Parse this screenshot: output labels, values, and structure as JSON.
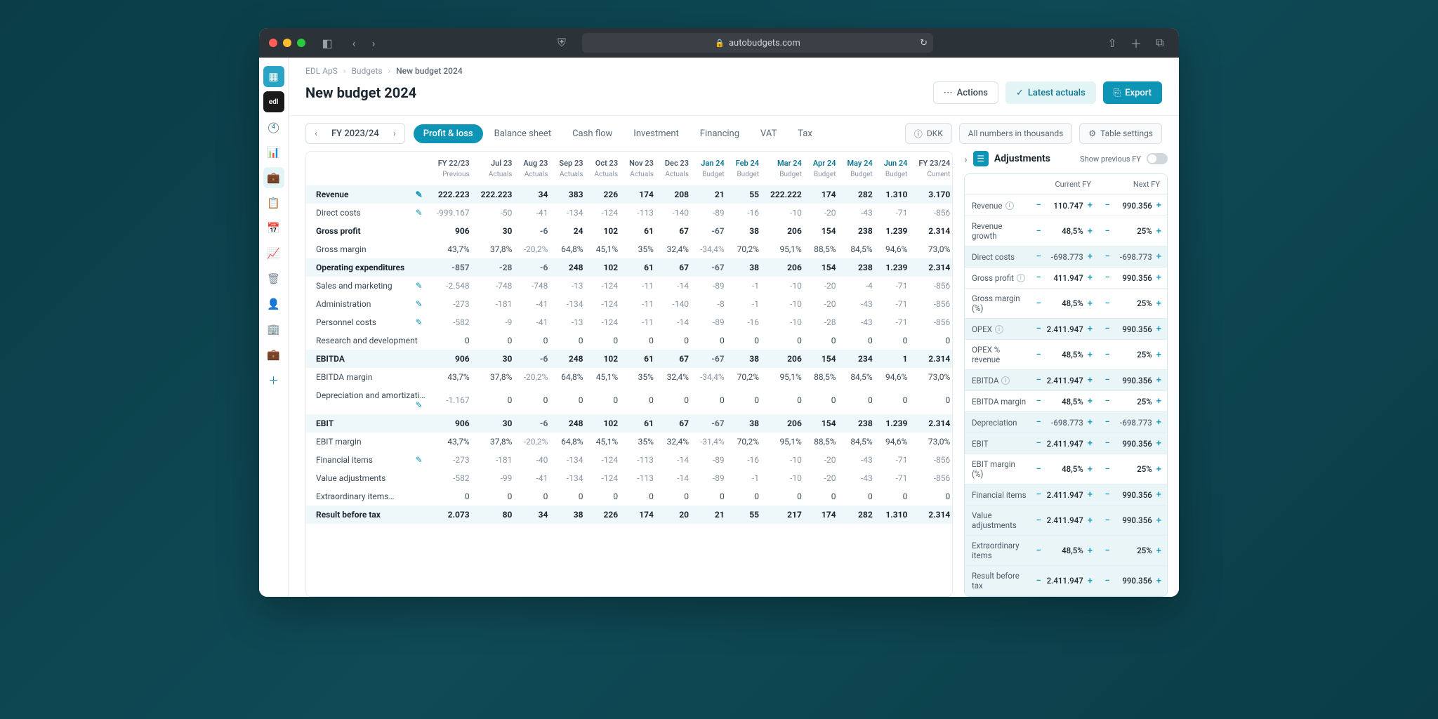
{
  "browser": {
    "url": "autobudgets.com"
  },
  "breadcrumbs": [
    "EDL ApS",
    "Budgets",
    "New budget 2024"
  ],
  "pageTitle": "New budget 2024",
  "headerButtons": {
    "actions": "Actions",
    "latest": "Latest actuals",
    "export": "Export"
  },
  "fy": "FY 2023/24",
  "tabs": [
    "Profit & loss",
    "Balance sheet",
    "Cash flow",
    "Investment",
    "Financing",
    "VAT",
    "Tax"
  ],
  "chips": {
    "currency": "DKK",
    "thousands": "All numbers in thousands",
    "settings": "Table settings"
  },
  "adjustments": {
    "title": "Adjustments",
    "showPrev": "Show previous FY",
    "cols": [
      "Current FY",
      "Next FY"
    ]
  },
  "columns": [
    {
      "p": "FY 22/23",
      "s": "Previous"
    },
    {
      "p": "Jul 23",
      "s": "Actuals"
    },
    {
      "p": "Aug 23",
      "s": "Actuals"
    },
    {
      "p": "Sep 23",
      "s": "Actuals"
    },
    {
      "p": "Oct 23",
      "s": "Actuals"
    },
    {
      "p": "Nov 23",
      "s": "Actuals"
    },
    {
      "p": "Dec 23",
      "s": "Actuals"
    },
    {
      "p": "Jan 24",
      "s": "Budget",
      "b": true
    },
    {
      "p": "Feb 24",
      "s": "Budget",
      "b": true
    },
    {
      "p": "Mar 24",
      "s": "Budget",
      "b": true
    },
    {
      "p": "Apr 24",
      "s": "Budget",
      "b": true
    },
    {
      "p": "May 24",
      "s": "Budget",
      "b": true
    },
    {
      "p": "Jun 24",
      "s": "Budget",
      "b": true
    },
    {
      "p": "FY 23/24",
      "s": "Current"
    }
  ],
  "rows": [
    {
      "label": "Revenue",
      "bold": true,
      "shaded": true,
      "edit": true,
      "vals": [
        "222.223",
        "222.223",
        "34",
        "383",
        "226",
        "174",
        "208",
        "21",
        "55",
        "222.222",
        "174",
        "282",
        "1.310",
        "3.170"
      ]
    },
    {
      "label": "Direct costs",
      "edit": true,
      "vals": [
        "-999.167",
        "-50",
        "-41",
        "-134",
        "-124",
        "-113",
        "-140",
        "-89",
        "-16",
        "-10",
        "-20",
        "-43",
        "-71",
        "-856"
      ]
    },
    {
      "label": "Gross profit",
      "bold": true,
      "vals": [
        "906",
        "30",
        "-6",
        "24",
        "102",
        "61",
        "67",
        "-67",
        "38",
        "206",
        "154",
        "238",
        "1.239",
        "2.314"
      ]
    },
    {
      "label": "Gross margin",
      "vals": [
        "43,7%",
        "37,8%",
        "-20,2%",
        "64,8%",
        "45,1%",
        "35%",
        "32,4%",
        "-34,4%",
        "70,2%",
        "95,1%",
        "88,5%",
        "84,5%",
        "94,6%",
        "73,0%"
      ]
    },
    {
      "label": "Operating expenditures",
      "bold": true,
      "shaded": true,
      "vals": [
        "-857",
        "-28",
        "-6",
        "248",
        "102",
        "61",
        "67",
        "-67",
        "38",
        "206",
        "154",
        "238",
        "1.239",
        "2.314"
      ]
    },
    {
      "label": "Sales and marketing",
      "edit": true,
      "vals": [
        "-2.548",
        "-748",
        "-748",
        "-13",
        "-124",
        "-11",
        "-14",
        "-89",
        "-1",
        "-10",
        "-20",
        "-4",
        "-71",
        "-856"
      ]
    },
    {
      "label": "Administration",
      "edit": true,
      "vals": [
        "-273",
        "-181",
        "-41",
        "-134",
        "-124",
        "-11",
        "-140",
        "-8",
        "-1",
        "-10",
        "-20",
        "-43",
        "-71",
        "-856"
      ]
    },
    {
      "label": "Personnel costs",
      "edit": true,
      "vals": [
        "-582",
        "-9",
        "-41",
        "-13",
        "-124",
        "-11",
        "-14",
        "-89",
        "-16",
        "-10",
        "-28",
        "-43",
        "-71",
        "-856"
      ]
    },
    {
      "label": "Research and development",
      "vals": [
        "0",
        "0",
        "0",
        "0",
        "0",
        "0",
        "0",
        "0",
        "0",
        "0",
        "0",
        "0",
        "0",
        "0"
      ]
    },
    {
      "label": "EBITDA",
      "bold": true,
      "shaded": true,
      "vals": [
        "906",
        "30",
        "-6",
        "248",
        "102",
        "61",
        "67",
        "-67",
        "38",
        "206",
        "154",
        "234",
        "1",
        "2.314"
      ]
    },
    {
      "label": "EBITDA margin",
      "vals": [
        "43,7%",
        "37,8%",
        "-20,2%",
        "64,8%",
        "45,1%",
        "35%",
        "32,4%",
        "-34,4%",
        "70,2%",
        "95,1%",
        "88,5%",
        "84,5%",
        "94,6%",
        "73,0%"
      ]
    },
    {
      "label": "Depreciation and amortizati…",
      "edit": true,
      "vals": [
        "-1.167",
        "0",
        "0",
        "0",
        "0",
        "0",
        "0",
        "0",
        "0",
        "0",
        "0",
        "0",
        "0",
        "0"
      ]
    },
    {
      "label": "EBIT",
      "bold": true,
      "shaded": true,
      "vals": [
        "906",
        "30",
        "-6",
        "248",
        "102",
        "61",
        "67",
        "-67",
        "38",
        "206",
        "154",
        "238",
        "1.239",
        "2.314"
      ]
    },
    {
      "label": "EBIT margin",
      "vals": [
        "43,7%",
        "37,8%",
        "-20,2%",
        "64,8%",
        "45,1%",
        "35%",
        "32,4%",
        "-31,4%",
        "70,2%",
        "95,1%",
        "88,5%",
        "84,5%",
        "94,6%",
        "73,0%"
      ]
    },
    {
      "label": "Financial items",
      "edit": true,
      "vals": [
        "-273",
        "-181",
        "-40",
        "-134",
        "-124",
        "-113",
        "-14",
        "-89",
        "-16",
        "-10",
        "-20",
        "-43",
        "-71",
        "-856"
      ]
    },
    {
      "label": "Value adjustments",
      "vals": [
        "-582",
        "-99",
        "-41",
        "-134",
        "-124",
        "-113",
        "-14",
        "-89",
        "-1",
        "-10",
        "-20",
        "-43",
        "-71",
        "-856"
      ]
    },
    {
      "label": "Extraordinary items…",
      "vals": [
        "0",
        "0",
        "0",
        "0",
        "0",
        "0",
        "0",
        "0",
        "0",
        "0",
        "0",
        "0",
        "0",
        "0"
      ]
    },
    {
      "label": "Result before tax",
      "bold": true,
      "shaded": true,
      "vals": [
        "2.073",
        "80",
        "34",
        "38",
        "226",
        "174",
        "20",
        "21",
        "55",
        "217",
        "174",
        "282",
        "1.310",
        "2.314"
      ]
    }
  ],
  "adjRows": [
    {
      "label": "Revenue",
      "info": true,
      "c": "110.747",
      "n": "990.356"
    },
    {
      "label": "Revenue growth",
      "c": "48,5%",
      "n": "25%"
    },
    {
      "label": "Direct costs",
      "shaded": true,
      "c": "-698.773",
      "n": "-698.773",
      "neg": true
    },
    {
      "label": "Gross profit",
      "info": true,
      "c": "411.947",
      "n": "990.356"
    },
    {
      "label": "Gross margin (%)",
      "c": "48,5%",
      "n": "25%"
    },
    {
      "label": "OPEX",
      "info": true,
      "shaded": true,
      "c": "2.411.947",
      "n": "990.356"
    },
    {
      "label": "OPEX % revenue",
      "c": "48,5%",
      "n": "25%"
    },
    {
      "label": "EBITDA",
      "info": true,
      "shaded": true,
      "c": "2.411.947",
      "n": "990.356"
    },
    {
      "label": "EBITDA margin",
      "c": "48,5%",
      "n": "25%"
    },
    {
      "label": "Depreciation",
      "shaded": true,
      "c": "-698.773",
      "n": "-698.773",
      "neg": true
    },
    {
      "label": "EBIT",
      "shaded": true,
      "c": "2.411.947",
      "n": "990.356"
    },
    {
      "label": "EBIT margin (%)",
      "c": "48,5%",
      "n": "25%"
    },
    {
      "label": "Financial items",
      "shaded": true,
      "c": "2.411.947",
      "n": "990.356"
    },
    {
      "label": "Value adjustments",
      "shaded": true,
      "c": "2.411.947",
      "n": "990.356"
    },
    {
      "label": "Extraordinary items",
      "shaded": true,
      "c": "48,5%",
      "n": "25%"
    },
    {
      "label": "Result before tax",
      "shaded": true,
      "c": "2.411.947",
      "n": "990.356"
    }
  ]
}
